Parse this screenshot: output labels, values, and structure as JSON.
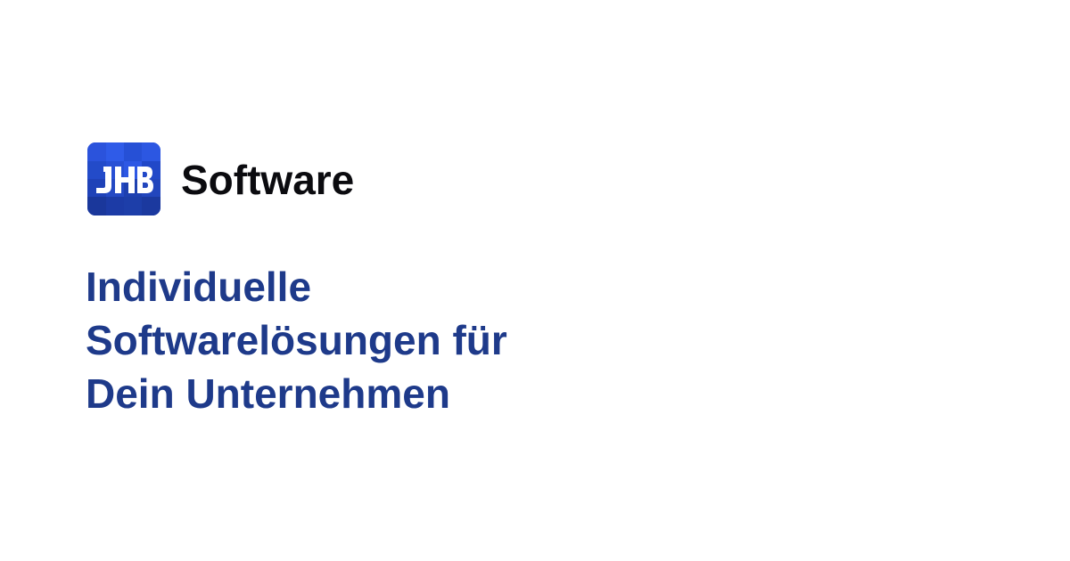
{
  "brand": {
    "logo_text": "JHB",
    "name": "Software",
    "logo_colors": {
      "light": "#2f5be8",
      "mid": "#2148c8",
      "dark": "#1a379b",
      "letters": "#ffffff"
    }
  },
  "headline": {
    "line1": "Individuelle",
    "line2": "Softwarelösungen für",
    "line3": "Dein Unternehmen",
    "color": "#1e3a8a"
  }
}
